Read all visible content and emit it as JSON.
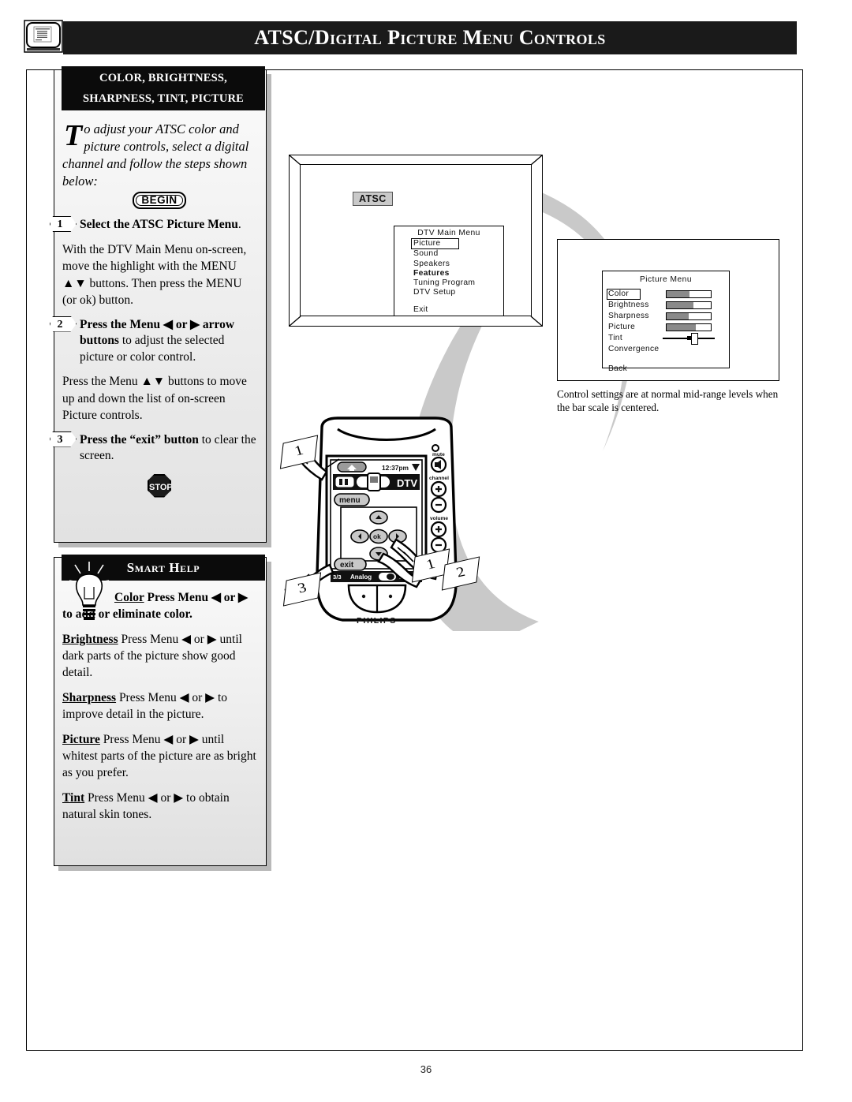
{
  "header": {
    "title": "ATSC/Digital Picture Menu Controls",
    "corner_icon": "tv-menu-icon"
  },
  "page_number": "36",
  "procedure": {
    "heading_line1": "COLOR, BRIGHTNESS,",
    "heading_line2": "SHARPNESS, TINT, PICTURE",
    "intro_dropcap": "T",
    "intro_text": "o adjust your ATSC color and picture controls, select a digital channel and follow the steps shown below:",
    "begin_badge": "BEGIN",
    "stop_badge": "STOP",
    "steps": [
      {
        "number": "1",
        "bold": "Select the ATSC Picture Menu",
        "rest": ".",
        "paragraphs": [
          "With the DTV Main Menu on-screen,  move the highlight with the MENU ▲▼  buttons. Then press the MENU (or ok) button."
        ]
      },
      {
        "number": "2",
        "bold": "Press the Menu ◀ or ▶  arrow buttons",
        "rest": " to adjust the selected picture or color control.",
        "paragraphs": [
          "Press the Menu ▲▼  buttons to move up and down the list of on-screen Picture controls."
        ]
      },
      {
        "number": "3",
        "bold": "Press the “exit” button",
        "rest": " to clear the screen.",
        "paragraphs": []
      }
    ]
  },
  "smart_help": {
    "title": "Smart Help",
    "icon": "lightbulb-icon",
    "items": [
      {
        "term": "Color",
        "text": " Press Menu ◀ or ▶ to add or eliminate color."
      },
      {
        "term": "Brightness",
        "text": " Press Menu ◀ or ▶ until dark parts of the picture show good detail."
      },
      {
        "term": "Sharpness",
        "text": " Press Menu ◀ or ▶ to improve detail in the picture."
      },
      {
        "term": "Picture",
        "text": " Press Menu ◀ or ▶ until whitest parts of the picture are as bright as you prefer."
      },
      {
        "term": "Tint",
        "text": " Press Menu ◀ or ▶ to obtain natural skin tones."
      }
    ]
  },
  "tv_screen": {
    "atsc_badge": "ATSC",
    "menu_title": "DTV Main Menu",
    "menu_items": [
      {
        "label": "Picture",
        "selected": true,
        "bold": false
      },
      {
        "label": "Sound",
        "selected": false,
        "bold": false
      },
      {
        "label": "Speakers",
        "selected": false,
        "bold": false
      },
      {
        "label": "Features",
        "selected": false,
        "bold": true
      },
      {
        "label": "Tuning   Program",
        "selected": false,
        "bold": false
      },
      {
        "label": "DTV Setup",
        "selected": false,
        "bold": false
      }
    ],
    "exit_label": "Exit"
  },
  "picture_menu": {
    "title": "Picture Menu",
    "rows": [
      {
        "label": "Color",
        "selected": true,
        "control": "bar",
        "value": 52
      },
      {
        "label": "Brightness",
        "selected": false,
        "control": "bar",
        "value": 60
      },
      {
        "label": "Sharpness",
        "selected": false,
        "control": "bar",
        "value": 50
      },
      {
        "label": "Picture",
        "selected": false,
        "control": "bar",
        "value": 66
      },
      {
        "label": "Tint",
        "selected": false,
        "control": "slider",
        "value": 50
      },
      {
        "label": "Convergence",
        "selected": false,
        "control": "none",
        "value": null
      }
    ],
    "back_label": "Back",
    "caption": "Control settings are at normal mid-range levels when the bar scale is centered."
  },
  "remote": {
    "brand": "PHILIPS",
    "lcd_time": "12:37pm",
    "lcd_mode": "DTV",
    "lcd_page": "3/3",
    "lcd_analog": "Analog",
    "lcd_dtv": "DTV",
    "buttons": {
      "menu": "menu",
      "exit": "exit",
      "ok": "ok"
    },
    "side_labels": [
      "mute",
      "channel",
      "volume"
    ],
    "callouts": [
      {
        "id": "callout-1-left",
        "value": "1"
      },
      {
        "id": "callout-1-right",
        "value": "1"
      },
      {
        "id": "callout-2",
        "value": "2"
      },
      {
        "id": "callout-3",
        "value": "3"
      }
    ]
  },
  "colors": {
    "header_bg": "#1a1a1a",
    "panel_bg": "#eeeeee",
    "swoosh": "#c9c9c9",
    "bar_fill": "#8a8a8a",
    "badge_bg": "#c9c9c9"
  }
}
